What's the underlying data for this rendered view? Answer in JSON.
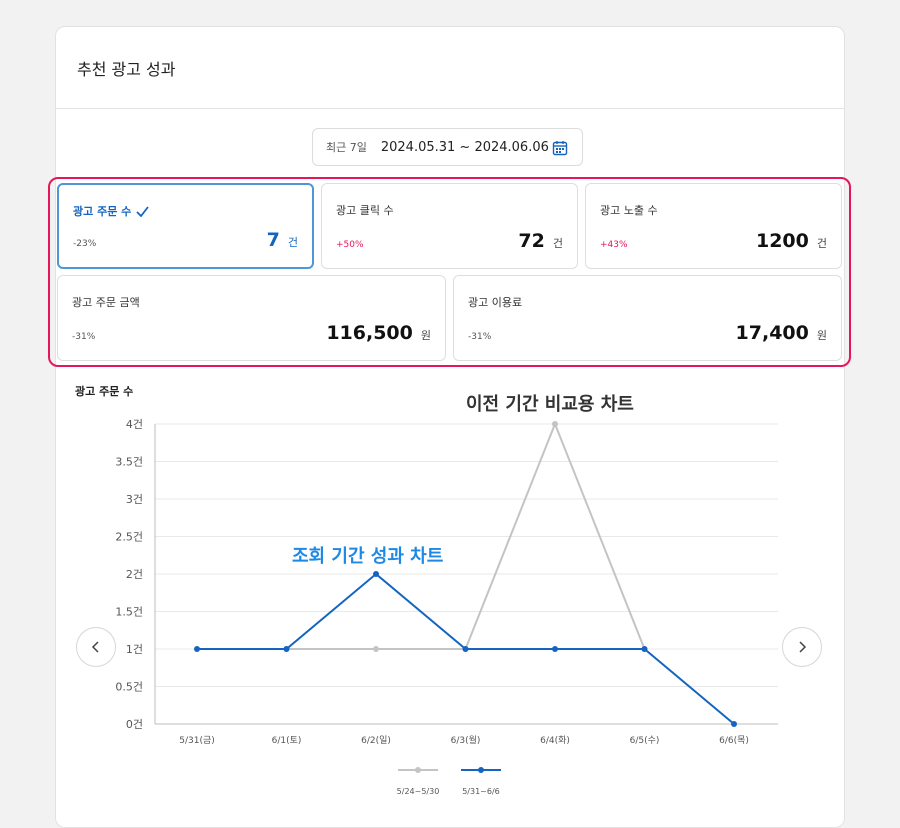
{
  "header": {
    "title": "추천 광고 성과"
  },
  "date_filter": {
    "period": "최근 7일",
    "range": "2024.05.31 ~ 2024.06.06"
  },
  "metrics": [
    {
      "label": "광고 주문 수",
      "change": "-23%",
      "value": "7",
      "unit": "건",
      "active": true
    },
    {
      "label": "광고 클릭 수",
      "change": "+50%",
      "value": "72",
      "unit": "건",
      "active": false
    },
    {
      "label": "광고 노출 수",
      "change": "+43%",
      "value": "1200",
      "unit": "건",
      "active": false
    },
    {
      "label": "광고 주문 금액",
      "change": "-31%",
      "value": "116,500",
      "unit": "원",
      "active": false
    },
    {
      "label": "광고 이용료",
      "change": "-31%",
      "value": "17,400",
      "unit": "원",
      "active": false
    }
  ],
  "annotations": {
    "previous": "이전 기간 비교용 차트",
    "current": "조회 기간 성과 차트"
  },
  "colors": {
    "accent": "#1565c0",
    "highlight_frame": "#e5175a",
    "previous_series": "#c4c4c4",
    "current_series": "#1565c0"
  },
  "chart_data": {
    "type": "line",
    "title": "광고 주문 수",
    "categories": [
      "5/31(금)",
      "6/1(토)",
      "6/2(일)",
      "6/3(월)",
      "6/4(화)",
      "6/5(수)",
      "6/6(목)"
    ],
    "y_ticks": [
      "0건",
      "0.5건",
      "1건",
      "1.5건",
      "2건",
      "2.5건",
      "3건",
      "3.5건",
      "4건"
    ],
    "ylim": [
      0,
      4
    ],
    "grid": true,
    "legend_position": "bottom",
    "series": [
      {
        "name": "5/24~5/30",
        "values": [
          null,
          1,
          1,
          1,
          4,
          1,
          null
        ],
        "color": "#c4c4c4"
      },
      {
        "name": "5/31~6/6",
        "values": [
          1,
          1,
          2,
          1,
          1,
          1,
          0
        ],
        "color": "#1565c0"
      }
    ]
  }
}
